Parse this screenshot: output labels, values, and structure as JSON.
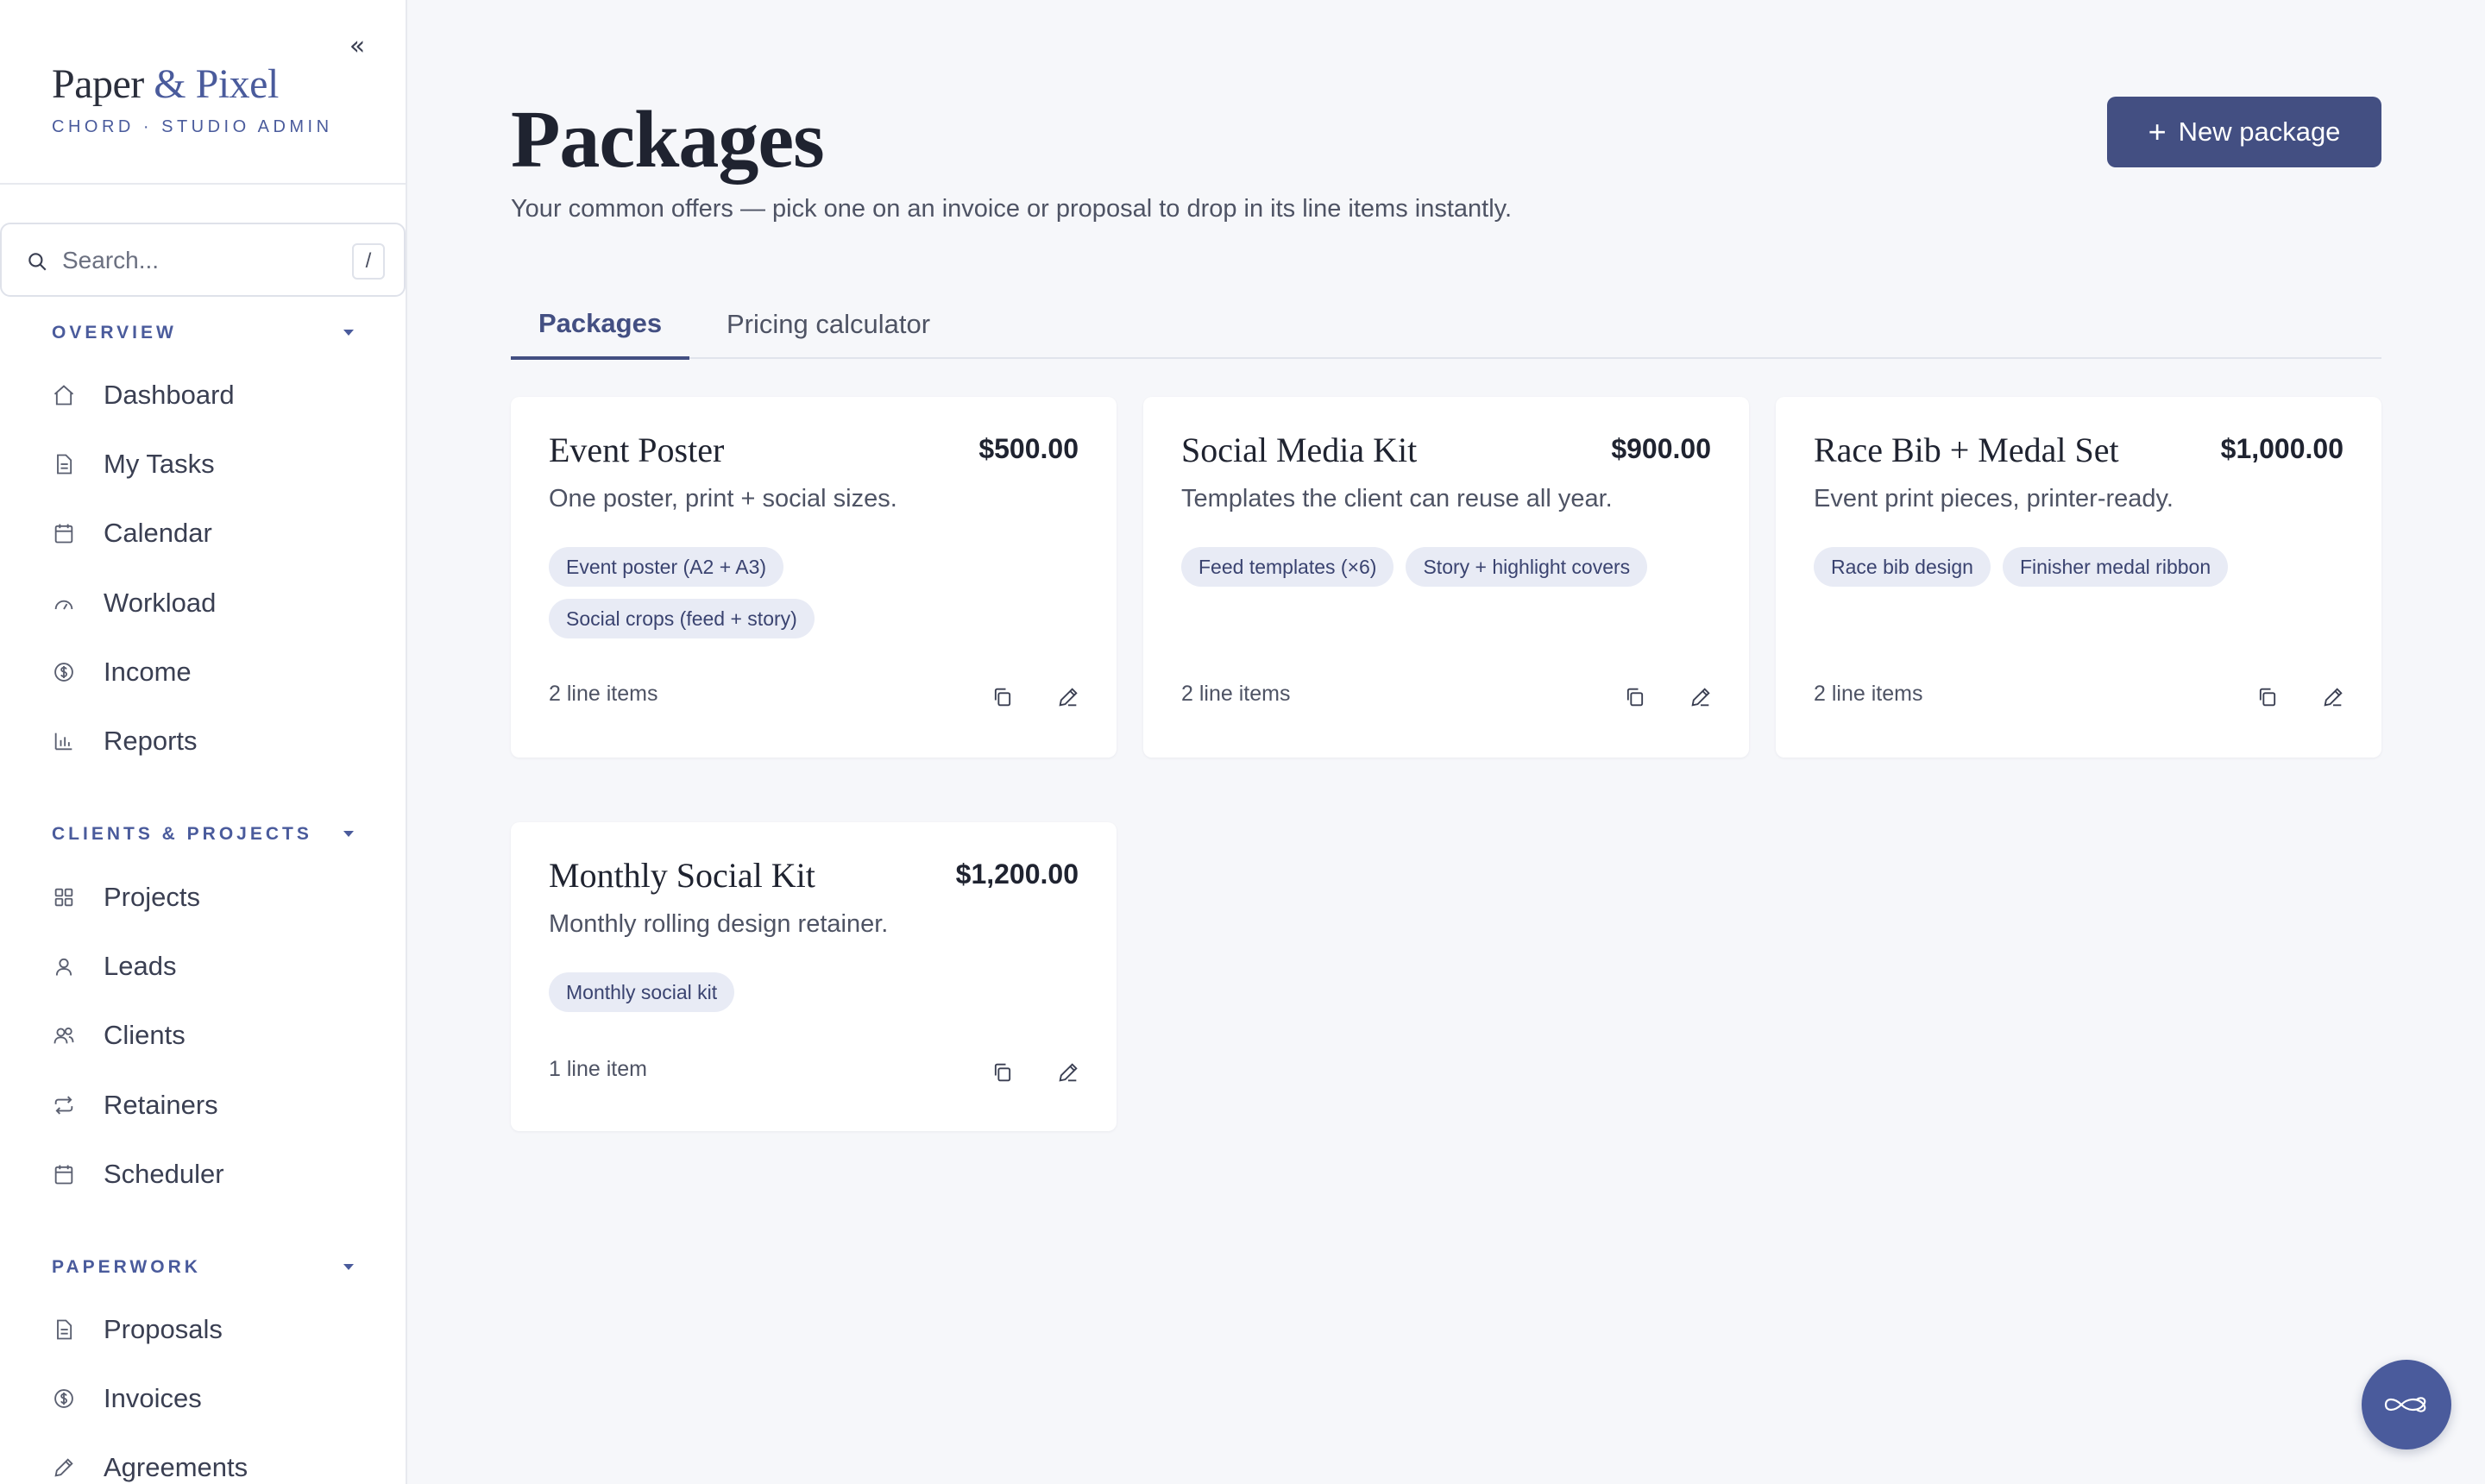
{
  "sidebar": {
    "collapse_label": "«",
    "brand": {
      "part1": "Paper ",
      "amp": "&",
      "part2": " Pixel",
      "subtitle": "CHORD · STUDIO ADMIN"
    },
    "search": {
      "placeholder": "Search...",
      "shortcut": "/"
    },
    "sections": [
      {
        "title": "OVERVIEW",
        "items": [
          {
            "label": "Dashboard",
            "icon": "home-icon"
          },
          {
            "label": "My Tasks",
            "icon": "document-icon"
          },
          {
            "label": "Calendar",
            "icon": "calendar-icon"
          },
          {
            "label": "Workload",
            "icon": "gauge-icon"
          },
          {
            "label": "Income",
            "icon": "dollar-icon"
          },
          {
            "label": "Reports",
            "icon": "bar-chart-icon"
          }
        ]
      },
      {
        "title": "CLIENTS & PROJECTS",
        "items": [
          {
            "label": "Projects",
            "icon": "grid-icon"
          },
          {
            "label": "Leads",
            "icon": "user-icon"
          },
          {
            "label": "Clients",
            "icon": "users-icon"
          },
          {
            "label": "Retainers",
            "icon": "repeat-icon"
          },
          {
            "label": "Scheduler",
            "icon": "calendar-icon"
          }
        ]
      },
      {
        "title": "PAPERWORK",
        "items": [
          {
            "label": "Proposals",
            "icon": "document-icon"
          },
          {
            "label": "Invoices",
            "icon": "dollar-icon"
          },
          {
            "label": "Agreements",
            "icon": "pen-icon"
          }
        ]
      }
    ]
  },
  "header": {
    "title": "Packages",
    "subtitle": "Your common offers — pick one on an invoice or proposal to drop in its line items instantly.",
    "new_button": "New package",
    "new_button_plus": "+"
  },
  "tabs": [
    {
      "label": "Packages",
      "active": true
    },
    {
      "label": "Pricing calculator",
      "active": false
    }
  ],
  "packages": [
    {
      "title": "Event Poster",
      "price": "$500.00",
      "description": "One poster, print + social sizes.",
      "chips": [
        "Event poster (A2 + A3)",
        "Social crops (feed + story)"
      ],
      "count": "2 line items"
    },
    {
      "title": "Social Media Kit",
      "price": "$900.00",
      "description": "Templates the client can reuse all year.",
      "chips": [
        "Feed templates (×6)",
        "Story + highlight covers"
      ],
      "count": "2 line items"
    },
    {
      "title": "Race Bib + Medal Set",
      "price": "$1,000.00",
      "description": "Event print pieces, printer-ready.",
      "chips": [
        "Race bib design",
        "Finisher medal ribbon"
      ],
      "count": "2 line items"
    },
    {
      "title": "Monthly Social Kit",
      "price": "$1,200.00",
      "description": "Monthly rolling design retainer.",
      "chips": [
        "Monthly social kit"
      ],
      "count": "1 line item"
    }
  ],
  "colors": {
    "accent": "#434f82",
    "brand": "#4a5b9c",
    "chip_bg": "#e8ebf5",
    "background": "#f6f7fa"
  }
}
